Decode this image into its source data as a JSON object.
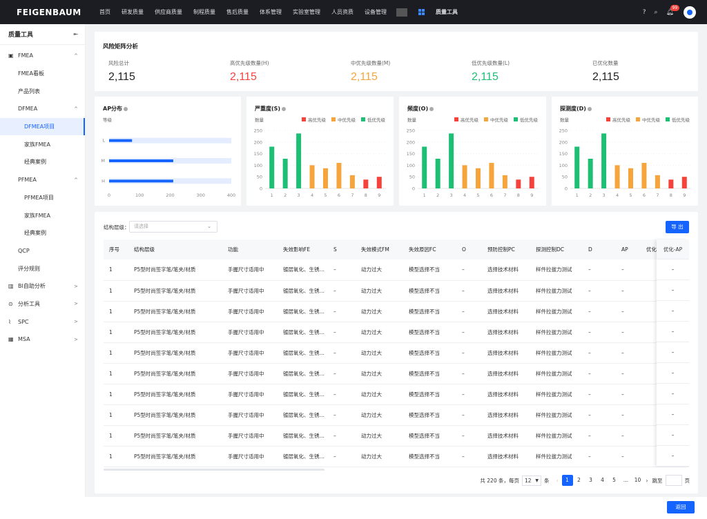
{
  "header": {
    "logo": "FEIGENBAUM",
    "nav": [
      "首页",
      "研发质量",
      "供应商质量",
      "制程质量",
      "售后质量",
      "体系管理",
      "实验室管理",
      "人员资质",
      "设备管理"
    ],
    "active_module": "质量工具",
    "notification_count": "99"
  },
  "sidebar": {
    "title": "质量工具",
    "items": [
      {
        "label": "FMEA",
        "level": 1,
        "icon": "fmea-icon",
        "chev": "^"
      },
      {
        "label": "FMEA看板",
        "level": 2
      },
      {
        "label": "产品列表",
        "level": 2
      },
      {
        "label": "DFMEA",
        "level": 2,
        "chev": "^"
      },
      {
        "label": "DFMEA项目",
        "level": 3,
        "selected": true
      },
      {
        "label": "家族FMEA",
        "level": 3
      },
      {
        "label": "经典案例",
        "level": 3
      },
      {
        "label": "PFMEA",
        "level": 2,
        "chev": "^"
      },
      {
        "label": "PFMEA项目",
        "level": 3
      },
      {
        "label": "家族FMEA",
        "level": 3
      },
      {
        "label": "经典案例",
        "level": 3
      },
      {
        "label": "QCP",
        "level": 2
      },
      {
        "label": "评分规则",
        "level": 2
      },
      {
        "label": "BI自助分析",
        "level": 1,
        "icon": "bar-chart-icon",
        "chev": ">"
      },
      {
        "label": "分析工具",
        "level": 1,
        "icon": "magnifier-icon",
        "chev": ">"
      },
      {
        "label": "SPC",
        "level": 1,
        "icon": "spc-icon",
        "chev": ">"
      },
      {
        "label": "MSA",
        "level": 1,
        "icon": "msa-icon",
        "chev": ">"
      }
    ]
  },
  "risk": {
    "title": "风险矩阵分析",
    "stats": [
      {
        "label": "风险总计",
        "value": "2,115",
        "color": "#222222"
      },
      {
        "label": "高优先级数量(H)",
        "value": "2,115",
        "color": "#f5433c"
      },
      {
        "label": "中优先级数量(M)",
        "value": "2,115",
        "color": "#f6a53c"
      },
      {
        "label": "低优先级数量(L)",
        "value": "2,115",
        "color": "#1cbf73"
      },
      {
        "label": "已优化数量",
        "value": "2,115",
        "color": "#222222"
      }
    ]
  },
  "chart_data": [
    {
      "type": "bar",
      "orientation": "horizontal",
      "title": "AP分布",
      "ylabel": "等级",
      "categories": [
        "L",
        "M",
        "H"
      ],
      "values": [
        75,
        210,
        210
      ],
      "xlim": [
        0,
        400
      ],
      "xticks": [
        "0",
        "100",
        "200",
        "300",
        "400"
      ],
      "color": "#1664ff",
      "track_color": "#e3edff"
    },
    {
      "type": "bar",
      "title": "严重度(S)",
      "ylabel": "数量",
      "categories": [
        "1",
        "2",
        "3",
        "4",
        "5",
        "6",
        "7",
        "8",
        "9"
      ],
      "values": [
        180,
        128,
        237,
        100,
        87,
        110,
        57,
        38,
        50
      ],
      "ylim": [
        0,
        250
      ],
      "yticks": [
        "0",
        "50",
        "100",
        "150",
        "200",
        "250"
      ],
      "legend": [
        "高优先级",
        "中优先级",
        "低优先级"
      ],
      "colors": [
        "#1cbf73",
        "#1cbf73",
        "#1cbf73",
        "#f6a53c",
        "#f6a53c",
        "#f6a53c",
        "#f6a53c",
        "#f5433c",
        "#f5433c"
      ]
    },
    {
      "type": "bar",
      "title": "频度(O)",
      "ylabel": "数量",
      "categories": [
        "1",
        "2",
        "3",
        "4",
        "5",
        "6",
        "7",
        "8",
        "9"
      ],
      "values": [
        180,
        128,
        237,
        100,
        87,
        110,
        57,
        38,
        50
      ],
      "ylim": [
        0,
        250
      ],
      "yticks": [
        "0",
        "50",
        "100",
        "150",
        "200",
        "250"
      ],
      "legend": [
        "高优先级",
        "中优先级",
        "低优先级"
      ],
      "colors": [
        "#1cbf73",
        "#1cbf73",
        "#1cbf73",
        "#f6a53c",
        "#f6a53c",
        "#f6a53c",
        "#f6a53c",
        "#f5433c",
        "#f5433c"
      ]
    },
    {
      "type": "bar",
      "title": "探测度(D)",
      "ylabel": "数量",
      "categories": [
        "1",
        "2",
        "3",
        "4",
        "5",
        "6",
        "7",
        "8",
        "9"
      ],
      "values": [
        180,
        128,
        237,
        100,
        87,
        110,
        57,
        38,
        50
      ],
      "ylim": [
        0,
        250
      ],
      "yticks": [
        "0",
        "50",
        "100",
        "150",
        "200",
        "250"
      ],
      "legend": [
        "高优先级",
        "中优先级",
        "低优先级"
      ],
      "colors": [
        "#1cbf73",
        "#1cbf73",
        "#1cbf73",
        "#f6a53c",
        "#f6a53c",
        "#f6a53c",
        "#f6a53c",
        "#f5433c",
        "#f5433c"
      ]
    }
  ],
  "legend_colors": [
    "#f5433c",
    "#f6a53c",
    "#1cbf73"
  ],
  "filter": {
    "label": "结构层级：",
    "placeholder": "请选择",
    "export_label": "导 出"
  },
  "table": {
    "columns": [
      "序号",
      "结构层级",
      "功能",
      "失效影响FE",
      "S",
      "失效模式FM",
      "失效原因FC",
      "O",
      "预防控制PC",
      "探测控制DC",
      "D",
      "AP",
      "优化"
    ],
    "fixed_column": "优化-AP",
    "rows": [
      [
        "1",
        "P5型时尚签字笔/笔夹/材质",
        "手握尺寸适用中",
        "镀层氧化、生锈…",
        "–",
        "动力过大",
        "模型选择不当",
        "–",
        "选择技术材料",
        "样件拉拔力测试",
        "–",
        "–",
        "",
        "–"
      ],
      [
        "1",
        "P5型时尚签字笔/笔夹/材质",
        "手握尺寸适用中",
        "镀层氧化、生锈…",
        "–",
        "动力过大",
        "模型选择不当",
        "–",
        "选择技术材料",
        "样件拉拔力测试",
        "–",
        "–",
        "",
        "–"
      ],
      [
        "1",
        "P5型时尚签字笔/笔夹/材质",
        "手握尺寸适用中",
        "镀层氧化、生锈…",
        "–",
        "动力过大",
        "模型选择不当",
        "–",
        "选择技术材料",
        "样件拉拔力测试",
        "–",
        "–",
        "",
        "–"
      ],
      [
        "1",
        "P5型时尚签字笔/笔夹/材质",
        "手握尺寸适用中",
        "镀层氧化、生锈…",
        "–",
        "动力过大",
        "模型选择不当",
        "–",
        "选择技术材料",
        "样件拉拔力测试",
        "–",
        "–",
        "",
        "–"
      ],
      [
        "1",
        "P5型时尚签字笔/笔夹/材质",
        "手握尺寸适用中",
        "镀层氧化、生锈…",
        "–",
        "动力过大",
        "模型选择不当",
        "–",
        "选择技术材料",
        "样件拉拔力测试",
        "–",
        "–",
        "",
        "–"
      ],
      [
        "1",
        "P5型时尚签字笔/笔夹/材质",
        "手握尺寸适用中",
        "镀层氧化、生锈…",
        "–",
        "动力过大",
        "模型选择不当",
        "–",
        "选择技术材料",
        "样件拉拔力测试",
        "–",
        "–",
        "",
        "–"
      ],
      [
        "1",
        "P5型时尚签字笔/笔夹/材质",
        "手握尺寸适用中",
        "镀层氧化、生锈…",
        "–",
        "动力过大",
        "模型选择不当",
        "–",
        "选择技术材料",
        "样件拉拔力测试",
        "–",
        "–",
        "",
        "–"
      ],
      [
        "1",
        "P5型时尚签字笔/笔夹/材质",
        "手握尺寸适用中",
        "镀层氧化、生锈…",
        "–",
        "动力过大",
        "模型选择不当",
        "–",
        "选择技术材料",
        "样件拉拔力测试",
        "–",
        "–",
        "",
        "–"
      ],
      [
        "1",
        "P5型时尚签字笔/笔夹/材质",
        "手握尺寸适用中",
        "镀层氧化、生锈…",
        "–",
        "动力过大",
        "模型选择不当",
        "–",
        "选择技术材料",
        "样件拉拔力测试",
        "–",
        "–",
        "",
        "–"
      ],
      [
        "1",
        "P5型时尚签字笔/笔夹/材质",
        "手握尺寸适用中",
        "镀层氧化、生锈…",
        "–",
        "动力过大",
        "模型选择不当",
        "–",
        "选择技术材料",
        "样件拉拔力测试",
        "–",
        "–",
        "",
        "–"
      ]
    ]
  },
  "pagination": {
    "total": "共 220 条，每页",
    "page_size": "12",
    "unit": "条",
    "pages": [
      "1",
      "2",
      "3",
      "4",
      "5",
      "...",
      "10"
    ],
    "current": "1",
    "jump_label": "跳至",
    "page_unit": "页"
  },
  "footer": {
    "back_label": "返回"
  }
}
